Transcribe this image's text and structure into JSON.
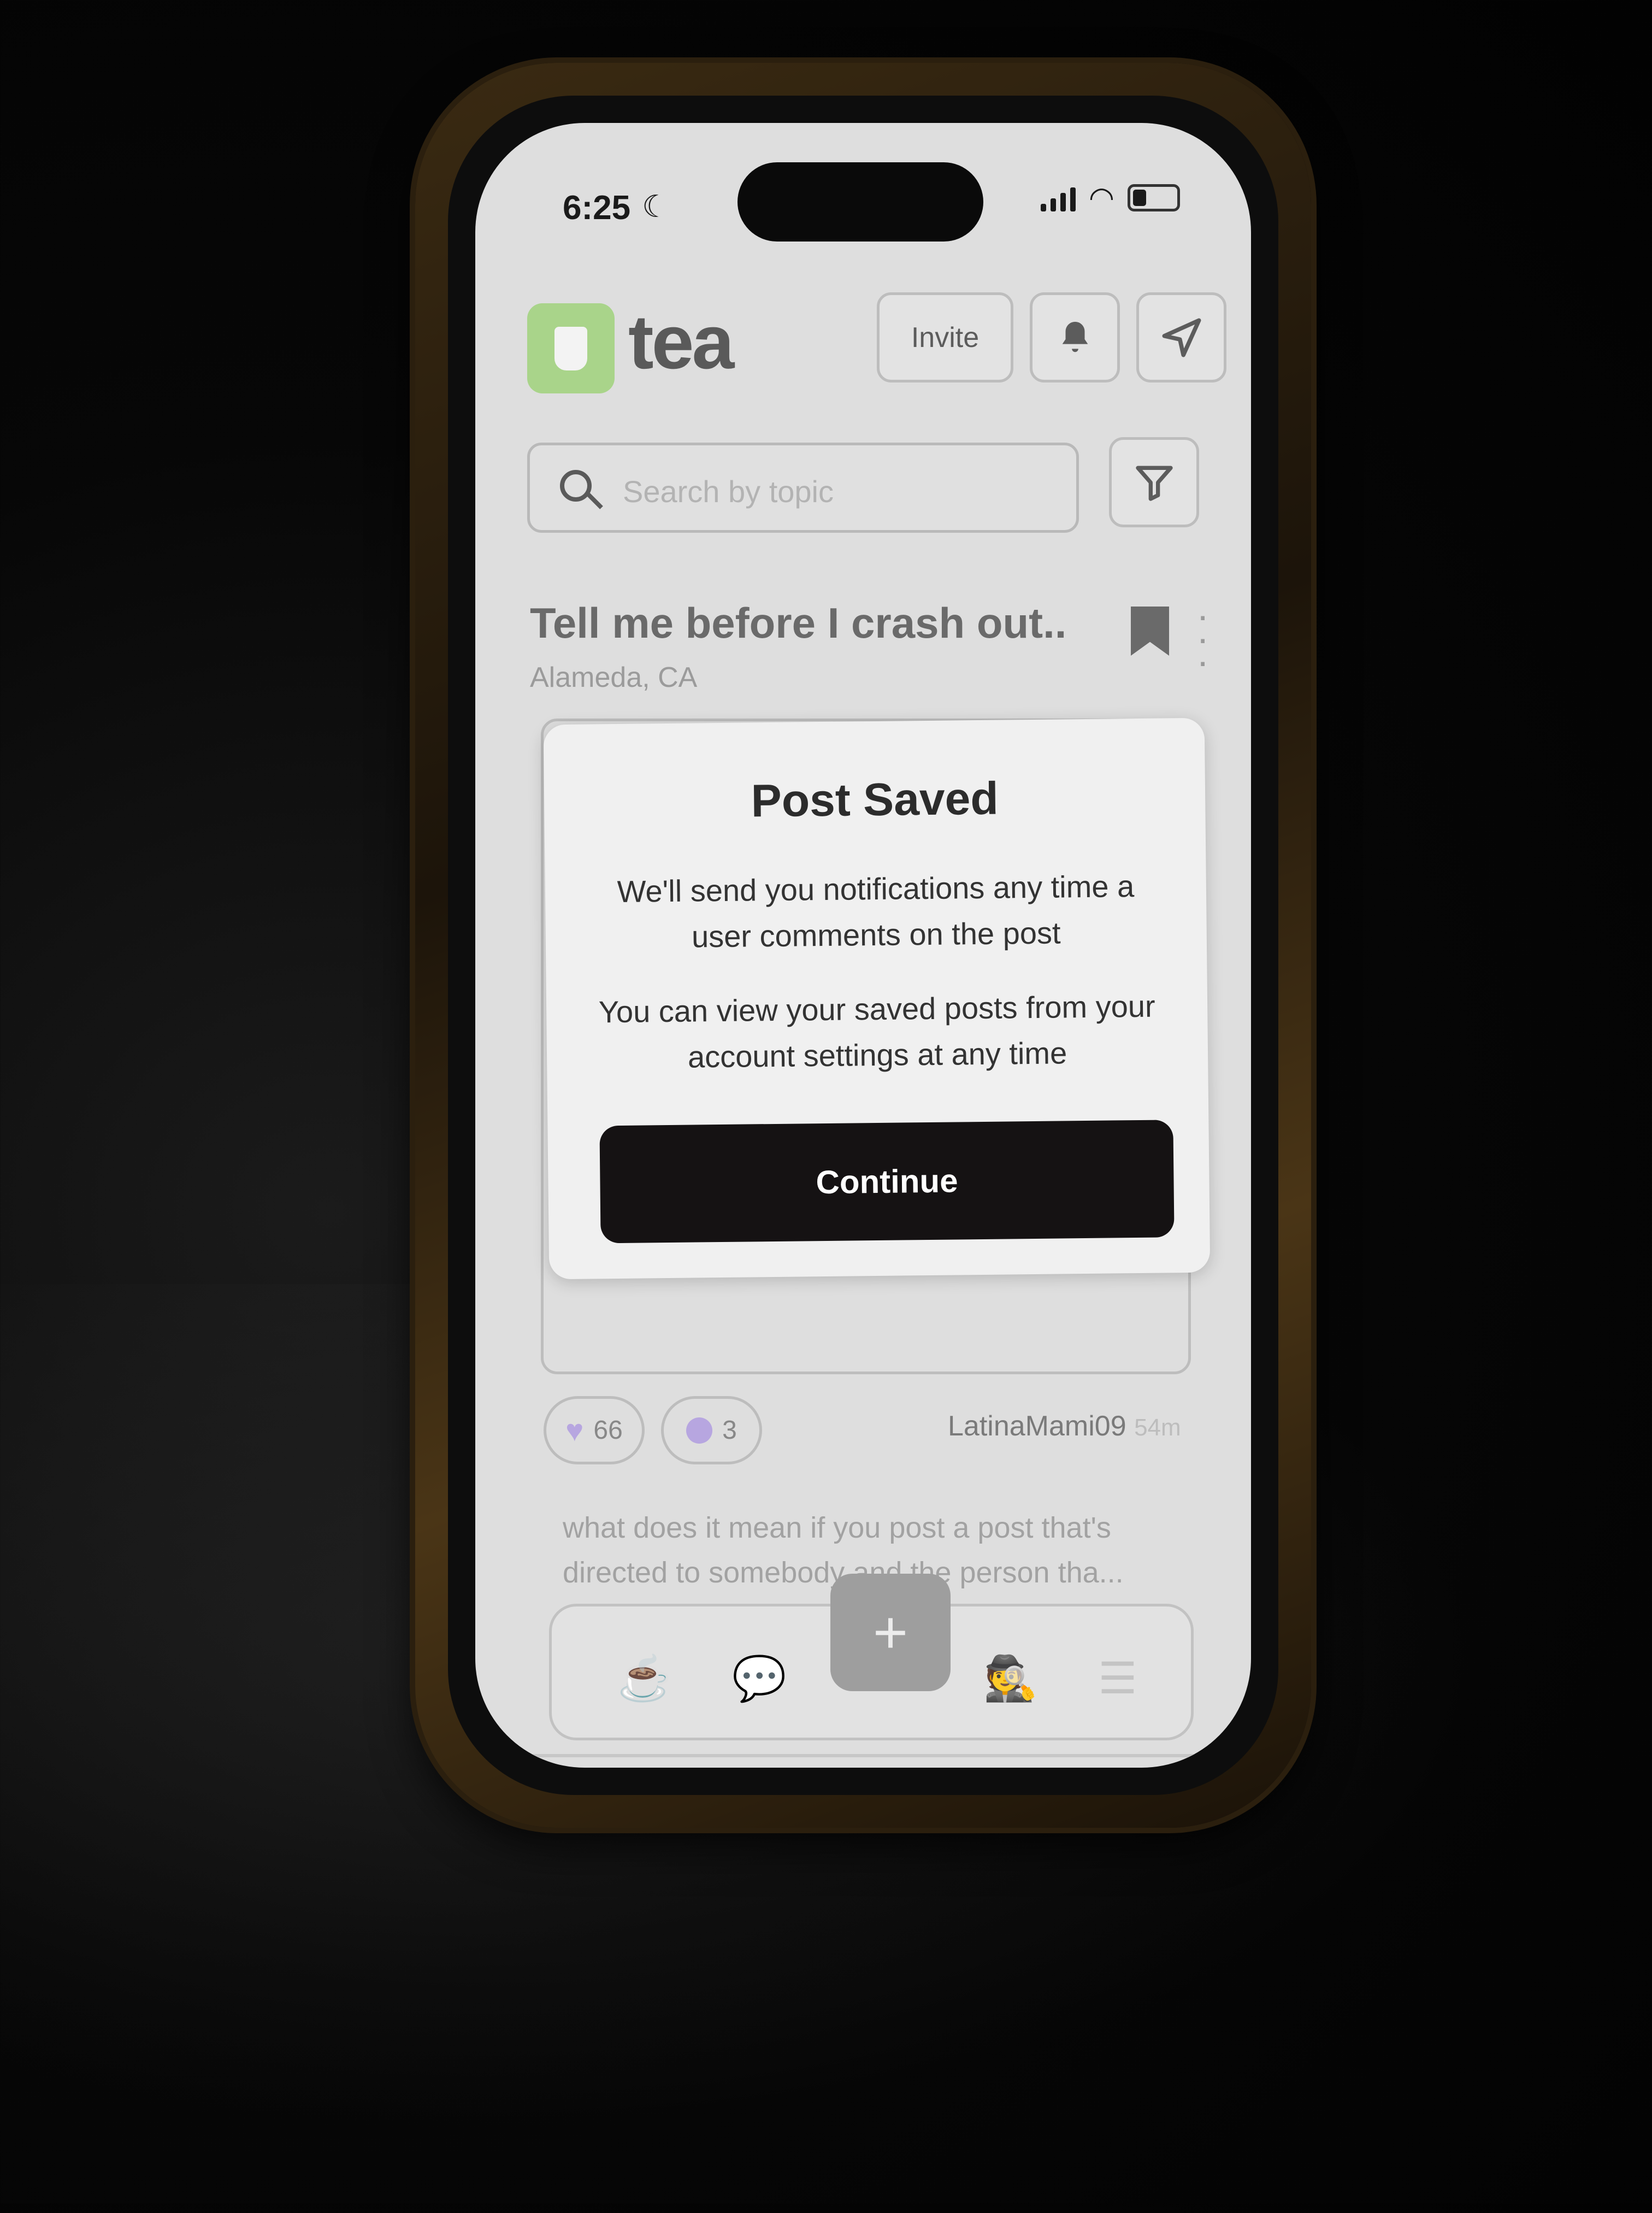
{
  "status_bar": {
    "time": "6:25",
    "moon": "☾",
    "wifi": "◠"
  },
  "header": {
    "app_name": "tea",
    "invite_label": "Invite",
    "bell_icon": "bell-icon",
    "send_icon": "paper-plane-icon"
  },
  "search": {
    "placeholder": "Search by topic",
    "filter_icon": "filter-icon"
  },
  "post": {
    "title": "Tell me before I crash out..",
    "location": "Alameda, CA",
    "likes": "66",
    "heart": "♥",
    "reactions": "3",
    "author": "LatinaMami09",
    "time_ago": "54m"
  },
  "next_post_preview": "what does it mean if you post a post that's directed to somebody and the person tha...",
  "tabbar": {
    "cup": "☕",
    "chat": "💬",
    "plus": "+",
    "spy": "🕵",
    "menu": "☰"
  },
  "dialog": {
    "title": "Post Saved",
    "line1": "We'll send you notifications any time a user comments on the post",
    "line2": "You can view your saved posts from your account settings at any time",
    "continue_label": "Continue"
  },
  "colors": {
    "logo_green": "#a9d48a",
    "accent_purple": "#b7a6e0",
    "button_dark": "#151213"
  }
}
